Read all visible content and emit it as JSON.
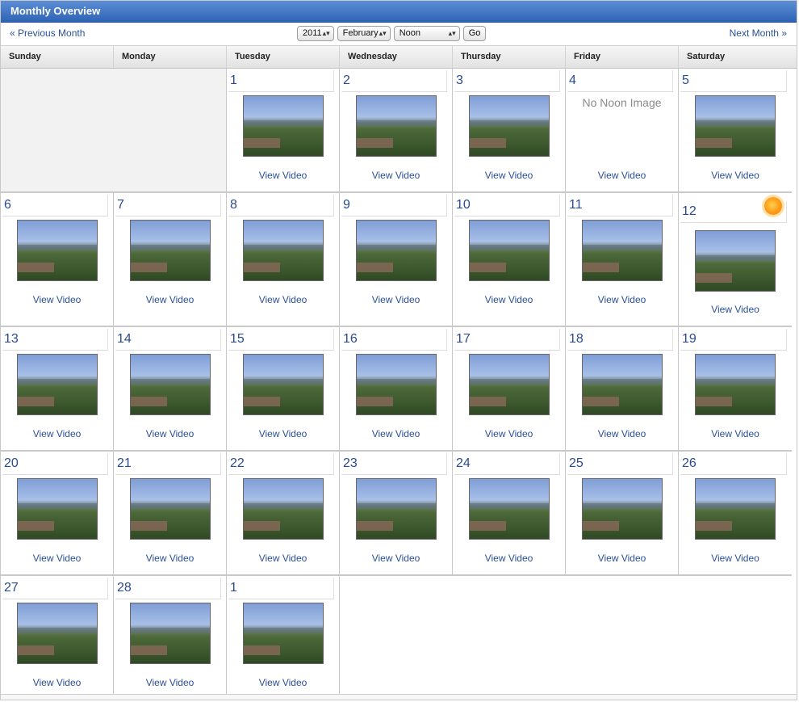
{
  "header": {
    "title": "Monthly Overview"
  },
  "toolbar": {
    "previous_month": "« Previous Month",
    "next_month": "Next Month »",
    "year": "2011",
    "month": "February",
    "time": "Noon",
    "go": "Go"
  },
  "weekdays": [
    "Sunday",
    "Monday",
    "Tuesday",
    "Wednesday",
    "Thursday",
    "Friday",
    "Saturday"
  ],
  "view_video_label": "View Video",
  "no_image_label": "No Noon Image",
  "weeks": {
    "w1": {
      "tue": "1",
      "wed": "2",
      "thu": "3",
      "fri": "4",
      "sat": "5"
    },
    "w2": {
      "sun": "6",
      "mon": "7",
      "tue": "8",
      "wed": "9",
      "thu": "10",
      "fri": "11",
      "sat": "12"
    },
    "w3": {
      "sun": "13",
      "mon": "14",
      "tue": "15",
      "wed": "16",
      "thu": "17",
      "fri": "18",
      "sat": "19"
    },
    "w4": {
      "sun": "20",
      "mon": "21",
      "tue": "22",
      "wed": "23",
      "thu": "24",
      "fri": "25",
      "sat": "26"
    },
    "w5": {
      "sun": "27",
      "mon": "28",
      "tue": "1"
    }
  },
  "icons": {
    "selected_day_marker": "sun-icon",
    "dropdown_arrow": "chevron-updown-icon"
  },
  "colors": {
    "titlebar_top": "#5c8fd6",
    "titlebar_bottom": "#2f63b5",
    "link": "#2a4f9a",
    "day_number": "#2a4b8f"
  }
}
